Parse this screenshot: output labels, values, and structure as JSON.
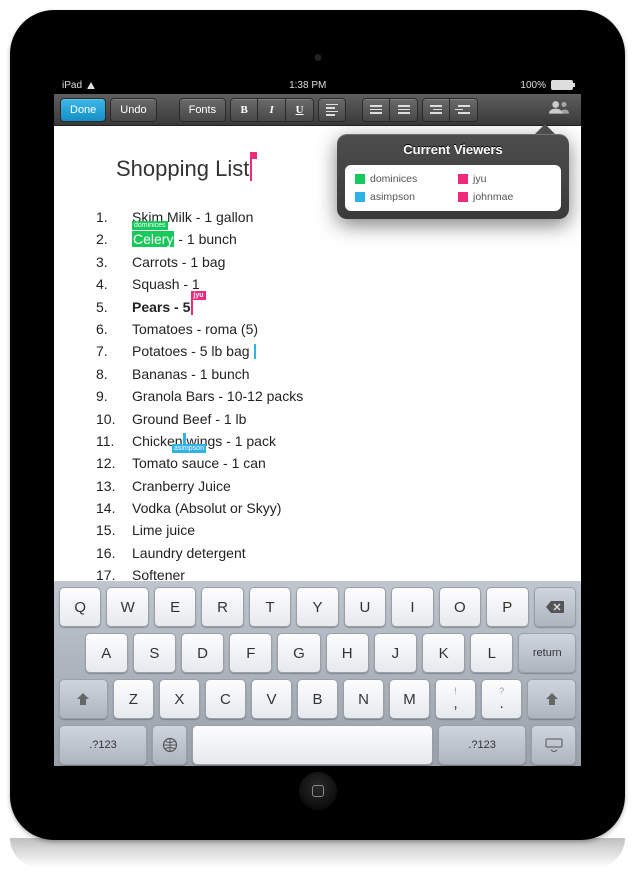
{
  "status": {
    "carrier": "iPad",
    "time": "1:38 PM",
    "battery": "100%"
  },
  "toolbar": {
    "done": "Done",
    "undo": "Undo",
    "fonts": "Fonts",
    "bold": "B",
    "italic": "I",
    "underline": "U"
  },
  "popover": {
    "title": "Current Viewers",
    "viewers": [
      {
        "name": "dominices",
        "color": "#17c95a"
      },
      {
        "name": "jyu",
        "color": "#ef2a7b"
      },
      {
        "name": "asimpson",
        "color": "#2db3e6"
      },
      {
        "name": "johnmae",
        "color": "#ef2a7b"
      }
    ]
  },
  "document": {
    "title": "Shopping List",
    "titleCursorColor": "#ef2a7b",
    "items": [
      {
        "n": "1.",
        "text": "Skim Milk - 1 gallon"
      },
      {
        "n": "2.",
        "pre": "",
        "hl": "Celery",
        "hlTag": "dominices",
        "hlColor": "#17c95a",
        "post": " - 1 bunch"
      },
      {
        "n": "3.",
        "text": "Carrots - 1 bag"
      },
      {
        "n": "4.",
        "text": "Squash - 1"
      },
      {
        "n": "5.",
        "text": "Pears - 5",
        "bold": true,
        "cursor": "#ef2a7b",
        "cursorTag": "jyu"
      },
      {
        "n": "6.",
        "text": "Tomatoes - roma (5)"
      },
      {
        "n": "7.",
        "text": "Potatoes - 5 lb bag ",
        "cursor": "#2db3e6"
      },
      {
        "n": "8.",
        "text": "Bananas - 1 bunch"
      },
      {
        "n": "9.",
        "text": "Granola Bars - 10-12 packs"
      },
      {
        "n": "10.",
        "text": "Ground Beef - 1 lb"
      },
      {
        "n": "11.",
        "pre": "Chicken",
        "sel": " ",
        "selTag": "asimpson",
        "selColor": "#2db3e6",
        "post": "wings - 1 pack"
      },
      {
        "n": "12.",
        "text": "Tomato sauce - 1 can"
      },
      {
        "n": "13.",
        "text": "Cranberry Juice"
      },
      {
        "n": "14.",
        "text": "Vodka (Absolut or Skyy)"
      },
      {
        "n": "15.",
        "text": "Lime juice"
      },
      {
        "n": "16.",
        "text": "Laundry detergent"
      },
      {
        "n": "17.",
        "text": "Softener"
      }
    ]
  },
  "keyboard": {
    "row1": [
      "Q",
      "W",
      "E",
      "R",
      "T",
      "Y",
      "U",
      "I",
      "O",
      "P"
    ],
    "row2": [
      "A",
      "S",
      "D",
      "F",
      "G",
      "H",
      "J",
      "K",
      "L"
    ],
    "row3": [
      "Z",
      "X",
      "C",
      "V",
      "B",
      "N",
      "M",
      "!",
      ","
    ],
    "return": "return",
    "numkey": ".?123"
  }
}
